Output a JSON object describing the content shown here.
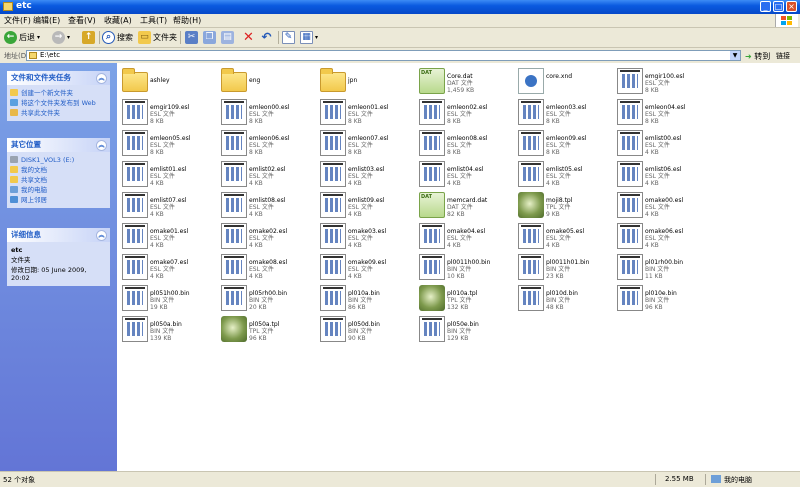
{
  "window": {
    "title": "etc"
  },
  "menu": [
    "文件(F)",
    "编辑(E)",
    "查看(V)",
    "收藏(A)",
    "工具(T)",
    "帮助(H)"
  ],
  "toolbar": {
    "back_label": "后退",
    "search_label": "搜索",
    "folders_label": "文件夹"
  },
  "address": {
    "label": "地址(D)",
    "value": "E:\\etc",
    "go_label": "转到",
    "links_label": "链接"
  },
  "left": {
    "tasks": {
      "title": "文件和文件夹任务",
      "items": [
        "创建一个新文件夹",
        "将这个文件夹发布到 Web",
        "共享此文件夹"
      ]
    },
    "places": {
      "title": "其它位置",
      "items": [
        "DISK1_VOL3 (E:)",
        "我的文档",
        "共享文档",
        "我的电脑",
        "网上邻居"
      ]
    },
    "details": {
      "title": "详细信息",
      "name": "etc",
      "type": "文件夹",
      "modified": "修改日期: 05 June 2009, 20:02"
    }
  },
  "files": [
    {
      "name": "ashley",
      "kind": "folder"
    },
    {
      "name": "eng",
      "kind": "folder"
    },
    {
      "name": "jpn",
      "kind": "folder"
    },
    {
      "name": "Core.dat",
      "kind": "dat",
      "type": "DAT 文件",
      "size": "1,459 KB"
    },
    {
      "name": "core.xnd",
      "kind": "xnd"
    },
    {
      "name": "emgir100.esl",
      "kind": "doc",
      "type": "ESL 文件",
      "size": "8 KB"
    },
    {
      "name": "emgir109.esl",
      "kind": "doc",
      "type": "ESL 文件",
      "size": "8 KB"
    },
    {
      "name": "emleon00.esl",
      "kind": "doc",
      "type": "ESL 文件",
      "size": "8 KB"
    },
    {
      "name": "emleon01.esl",
      "kind": "doc",
      "type": "ESL 文件",
      "size": "8 KB"
    },
    {
      "name": "emleon02.esl",
      "kind": "doc",
      "type": "ESL 文件",
      "size": "8 KB"
    },
    {
      "name": "emleon03.esl",
      "kind": "doc",
      "type": "ESL 文件",
      "size": "8 KB"
    },
    {
      "name": "emleon04.esl",
      "kind": "doc",
      "type": "ESL 文件",
      "size": "8 KB"
    },
    {
      "name": "emleon05.esl",
      "kind": "doc",
      "type": "ESL 文件",
      "size": "8 KB"
    },
    {
      "name": "emleon06.esl",
      "kind": "doc",
      "type": "ESL 文件",
      "size": "8 KB"
    },
    {
      "name": "emleon07.esl",
      "kind": "doc",
      "type": "ESL 文件",
      "size": "8 KB"
    },
    {
      "name": "emleon08.esl",
      "kind": "doc",
      "type": "ESL 文件",
      "size": "8 KB"
    },
    {
      "name": "emleon09.esl",
      "kind": "doc",
      "type": "ESL 文件",
      "size": "8 KB"
    },
    {
      "name": "emlist00.esl",
      "kind": "doc",
      "type": "ESL 文件",
      "size": "4 KB"
    },
    {
      "name": "emlist01.esl",
      "kind": "doc",
      "type": "ESL 文件",
      "size": "4 KB"
    },
    {
      "name": "emlist02.esl",
      "kind": "doc",
      "type": "ESL 文件",
      "size": "4 KB"
    },
    {
      "name": "emlist03.esl",
      "kind": "doc",
      "type": "ESL 文件",
      "size": "4 KB"
    },
    {
      "name": "emlist04.esl",
      "kind": "doc",
      "type": "ESL 文件",
      "size": "4 KB"
    },
    {
      "name": "emlist05.esl",
      "kind": "doc",
      "type": "ESL 文件",
      "size": "4 KB"
    },
    {
      "name": "emlist06.esl",
      "kind": "doc",
      "type": "ESL 文件",
      "size": "4 KB"
    },
    {
      "name": "emlist07.esl",
      "kind": "doc",
      "type": "ESL 文件",
      "size": "4 KB"
    },
    {
      "name": "emlist08.esl",
      "kind": "doc",
      "type": "ESL 文件",
      "size": "4 KB"
    },
    {
      "name": "emlist09.esl",
      "kind": "doc",
      "type": "ESL 文件",
      "size": "4 KB"
    },
    {
      "name": "memcard.dat",
      "kind": "dat",
      "type": "DAT 文件",
      "size": "82 KB"
    },
    {
      "name": "moji8.tpl",
      "kind": "tpl",
      "type": "TPL 文件",
      "size": "9 KB"
    },
    {
      "name": "omake00.esl",
      "kind": "doc",
      "type": "ESL 文件",
      "size": "4 KB"
    },
    {
      "name": "omake01.esl",
      "kind": "doc",
      "type": "ESL 文件",
      "size": "4 KB"
    },
    {
      "name": "omake02.esl",
      "kind": "doc",
      "type": "ESL 文件",
      "size": "4 KB"
    },
    {
      "name": "omake03.esl",
      "kind": "doc",
      "type": "ESL 文件",
      "size": "4 KB"
    },
    {
      "name": "omake04.esl",
      "kind": "doc",
      "type": "ESL 文件",
      "size": "4 KB"
    },
    {
      "name": "omake05.esl",
      "kind": "doc",
      "type": "ESL 文件",
      "size": "4 KB"
    },
    {
      "name": "omake06.esl",
      "kind": "doc",
      "type": "ESL 文件",
      "size": "4 KB"
    },
    {
      "name": "omake07.esl",
      "kind": "doc",
      "type": "ESL 文件",
      "size": "4 KB"
    },
    {
      "name": "omake08.esl",
      "kind": "doc",
      "type": "ESL 文件",
      "size": "4 KB"
    },
    {
      "name": "omake09.esl",
      "kind": "doc",
      "type": "ESL 文件",
      "size": "4 KB"
    },
    {
      "name": "pl0011h00.bin",
      "kind": "doc",
      "type": "BIN 文件",
      "size": "10 KB"
    },
    {
      "name": "pl0011h01.bin",
      "kind": "doc",
      "type": "BIN 文件",
      "size": "23 KB"
    },
    {
      "name": "pl01rh00.bin",
      "kind": "doc",
      "type": "BIN 文件",
      "size": "11 KB"
    },
    {
      "name": "pl051h00.bin",
      "kind": "doc",
      "type": "BIN 文件",
      "size": "19 KB"
    },
    {
      "name": "pl05rh00.bin",
      "kind": "doc",
      "type": "BIN 文件",
      "size": "20 KB"
    },
    {
      "name": "pl010a.bin",
      "kind": "doc",
      "type": "BIN 文件",
      "size": "86 KB"
    },
    {
      "name": "pl010a.tpl",
      "kind": "tpl",
      "type": "TPL 文件",
      "size": "132 KB"
    },
    {
      "name": "pl010d.bin",
      "kind": "doc",
      "type": "BIN 文件",
      "size": "48 KB"
    },
    {
      "name": "pl010e.bin",
      "kind": "doc",
      "type": "BIN 文件",
      "size": "96 KB"
    },
    {
      "name": "pl050a.bin",
      "kind": "doc",
      "type": "BIN 文件",
      "size": "139 KB"
    },
    {
      "name": "pl050a.tpl",
      "kind": "tpl",
      "type": "TPL 文件",
      "size": "96 KB"
    },
    {
      "name": "pl050d.bin",
      "kind": "doc",
      "type": "BIN 文件",
      "size": "90 KB"
    },
    {
      "name": "pl050e.bin",
      "kind": "doc",
      "type": "BIN 文件",
      "size": "129 KB"
    }
  ],
  "status": {
    "count": "52 个对象",
    "size": "2.55 MB",
    "location": "我的电脑"
  }
}
